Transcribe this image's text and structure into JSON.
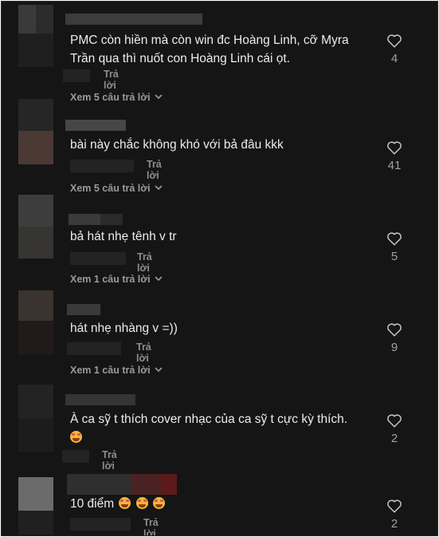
{
  "ui": {
    "reply_label": "Trả lời"
  },
  "comments": [
    {
      "text": "PMC còn hiền mà còn win đc Hoàng Linh, cỡ Myra Trần qua thì nuốt con Hoàng Linh cái ọt.",
      "likes": "4",
      "view_replies": "Xem 5 câu trả lời"
    },
    {
      "text": "bài này chắc không khó với bả đâu kkk",
      "likes": "41",
      "view_replies": "Xem 5 câu trả lời"
    },
    {
      "text": "bả hát nhẹ tênh v tr",
      "likes": "5",
      "view_replies": "Xem 1 câu trả lời"
    },
    {
      "text": "hát nhẹ nhàng v =))",
      "likes": "9",
      "view_replies": "Xem 1 câu trả lời"
    },
    {
      "text": "À ca sỹ t thích cover nhạc của ca sỹ t cực kỳ thích.",
      "likes": "2"
    },
    {
      "text": "10 điểm",
      "likes": "2"
    }
  ],
  "icons": {
    "like": "heart-outline-icon",
    "expand": "chevron-down-icon",
    "emoji": "smiling-face-with-hearts-icon"
  },
  "colors": {
    "background": "#151515",
    "text": "#ececec",
    "muted": "#8e8e8e"
  }
}
